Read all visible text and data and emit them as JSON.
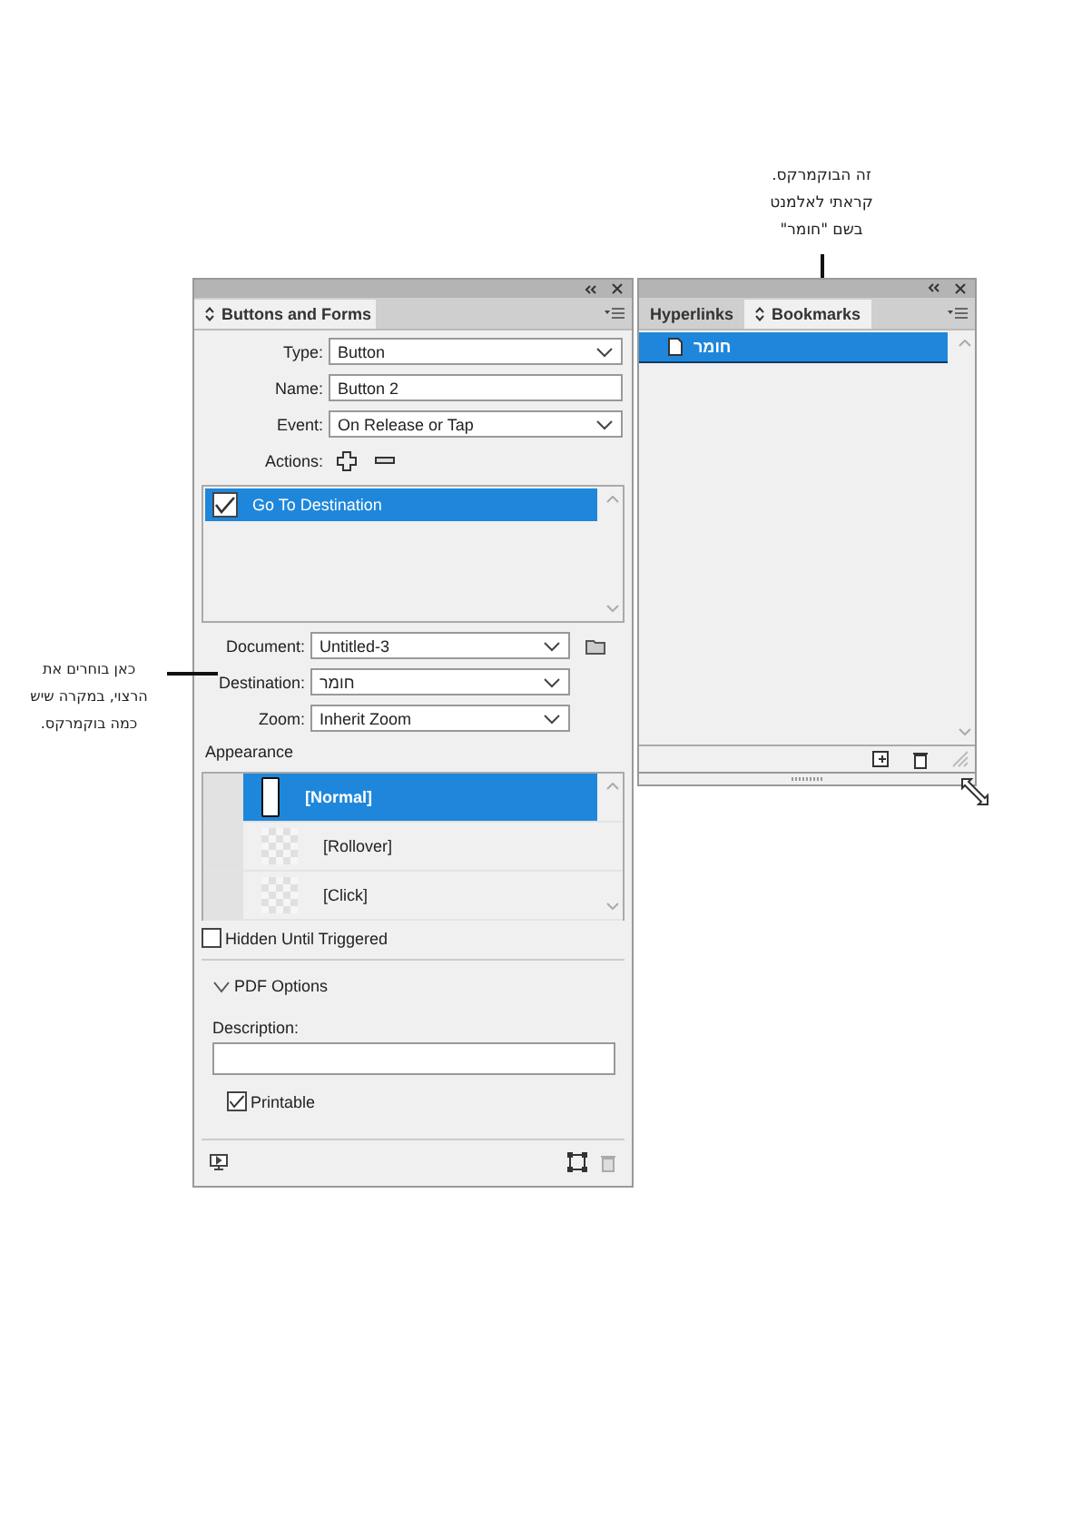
{
  "notes": [
    {
      "kind": "top",
      "lines": [
        "זה הבוקמרקס.",
        "קראתי לאלמנט",
        "בשם \"חומר\""
      ]
    },
    {
      "kind": "left",
      "lines": [
        "כאן בוחרים את",
        "הרצוי, במקרה שיש",
        "כמה בוקמרקס."
      ]
    }
  ],
  "buttons_panel": {
    "title": "Buttons and Forms",
    "top_fields": [
      {
        "label": "Type:",
        "value": "Button",
        "kind": "dropdown"
      },
      {
        "label": "Name:",
        "value": "Button 2",
        "kind": "text"
      },
      {
        "label": "Event:",
        "value": "On Release or Tap",
        "kind": "dropdown"
      }
    ],
    "actions_label": "Actions:",
    "actions": [
      {
        "label": "Go To Destination",
        "checked": true,
        "selected": true
      }
    ],
    "dest_fields": [
      {
        "label": "Document:",
        "value": "Untitled-3",
        "kind": "dropdown"
      },
      {
        "label": "Destination:",
        "value": "חומר",
        "kind": "dropdown"
      },
      {
        "label": "Zoom:",
        "value": "Inherit Zoom",
        "kind": "dropdown"
      }
    ],
    "appearance_label": "Appearance",
    "appearance": [
      {
        "label": "[Normal]",
        "selected": true
      },
      {
        "label": "[Rollover]",
        "selected": false
      },
      {
        "label": "[Click]",
        "selected": false
      }
    ],
    "hidden_until_triggered": {
      "label": "Hidden Until Triggered",
      "checked": false
    },
    "pdf_options": {
      "label": "PDF Options",
      "expanded": true
    },
    "description_label": "Description:",
    "printable": {
      "label": "Printable",
      "checked": true
    }
  },
  "bookmarks_panel": {
    "tabs": [
      {
        "label": "Hyperlinks",
        "selected": false
      },
      {
        "label": "Bookmarks",
        "selected": true
      }
    ],
    "items": [
      {
        "label": "חומר",
        "selected": true
      }
    ]
  }
}
